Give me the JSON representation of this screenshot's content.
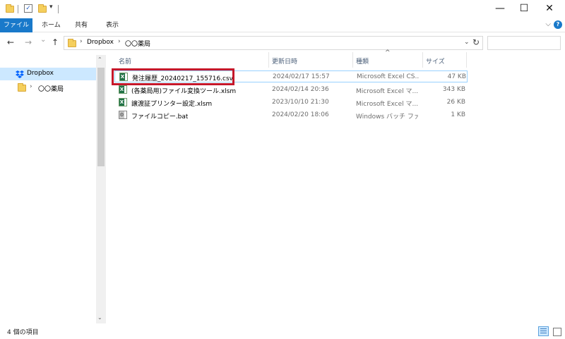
{
  "window": {
    "qa_sep": "|",
    "qa_dropdown": "▾",
    "minimize": "—",
    "maximize": "☐",
    "close": "✕"
  },
  "ribbon": {
    "file_tab": "ファイル",
    "tabs": [
      "ホーム",
      "共有",
      "表示"
    ],
    "collapse": "⌵",
    "help": "?"
  },
  "address": {
    "back": "←",
    "forward": "→",
    "recent": "⌄",
    "up": "↑",
    "crumbs": [
      "Dropbox",
      "〇〇薬局"
    ],
    "chevron": "›",
    "dropdown": "⌄",
    "refresh": "↻",
    "search_placeholder": ""
  },
  "navpane": {
    "items": [
      {
        "label": "Dropbox",
        "selected": true
      },
      {
        "label": "〇〇薬局",
        "expand": "›"
      }
    ],
    "scroll_down": "⌄"
  },
  "columns": {
    "name": "名前",
    "modified": "更新日時",
    "type": "種類",
    "size": "サイズ",
    "sort_indicator": "^"
  },
  "files": [
    {
      "name": "発注履歴_20240217_155716.csv",
      "modified": "2024/02/17 15:57",
      "type": "Microsoft Excel CS...",
      "size": "47 KB",
      "icon": "excel-csv-icon",
      "selected": true
    },
    {
      "name": "(各薬局用)ファイル変換ツール.xlsm",
      "modified": "2024/02/14 20:36",
      "type": "Microsoft Excel マ...",
      "size": "343 KB",
      "icon": "excel-macro-icon"
    },
    {
      "name": "譲渡証プリンター設定.xlsm",
      "modified": "2023/10/10 21:30",
      "type": "Microsoft Excel マ...",
      "size": "26 KB",
      "icon": "excel-macro-icon"
    },
    {
      "name": "ファイルコピー.bat",
      "modified": "2024/02/20 18:06",
      "type": "Windows バッチ ファ...",
      "size": "1 KB",
      "icon": "batch-file-icon"
    }
  ],
  "status": {
    "item_count": "4 個の項目"
  },
  "colors": {
    "file_tab_bg": "#1979ca",
    "selection_bg": "#cce8ff",
    "highlight_box": "#c5182b"
  }
}
